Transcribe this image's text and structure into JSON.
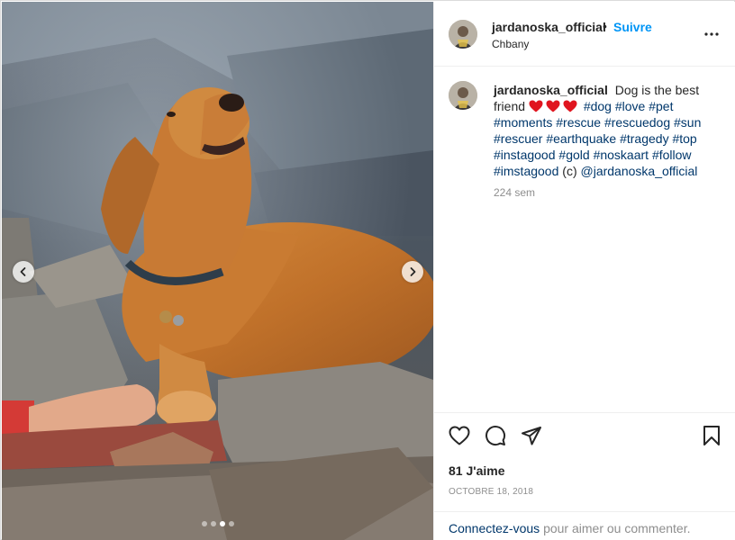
{
  "post": {
    "username": "jardanoska_official",
    "follow_label": "Suivre",
    "separator": "•",
    "location": "Chbany",
    "caption_text": "Dog is the best friend",
    "caption_emojis": [
      "red-heart-icon",
      "red-heart-icon",
      "red-heart-icon"
    ],
    "hashtags": [
      "#dog",
      "#love",
      "#pet",
      "#moments",
      "#rescue",
      "#rescuedog",
      "#sun",
      "#rescuer",
      "#earthquake",
      "#tragedy",
      "#top",
      "#instagood",
      "#gold",
      "#noskaart",
      "#follow",
      "#imstagood"
    ],
    "caption_suffix": "(c)",
    "mention": "@jardanoska_official",
    "relative_time": "224 sem",
    "likes": "81 J'aime",
    "date": "OCTOBRE 18, 2018",
    "login_link": "Connectez-vous",
    "login_suffix": "pour aimer ou commenter.",
    "carousel": {
      "slide_count": 4,
      "active_index": 2
    }
  },
  "colors": {
    "link_blue": "#0095f6",
    "hashtag_blue": "#00376b",
    "muted": "#8e8e8e",
    "heart_red": "#e0151f"
  },
  "icons": {
    "more": "more-horizontal-icon",
    "like": "heart-outline-icon",
    "comment": "comment-bubble-icon",
    "share": "paper-plane-icon",
    "save": "bookmark-icon",
    "prev": "chevron-left-icon",
    "next": "chevron-right-icon"
  }
}
